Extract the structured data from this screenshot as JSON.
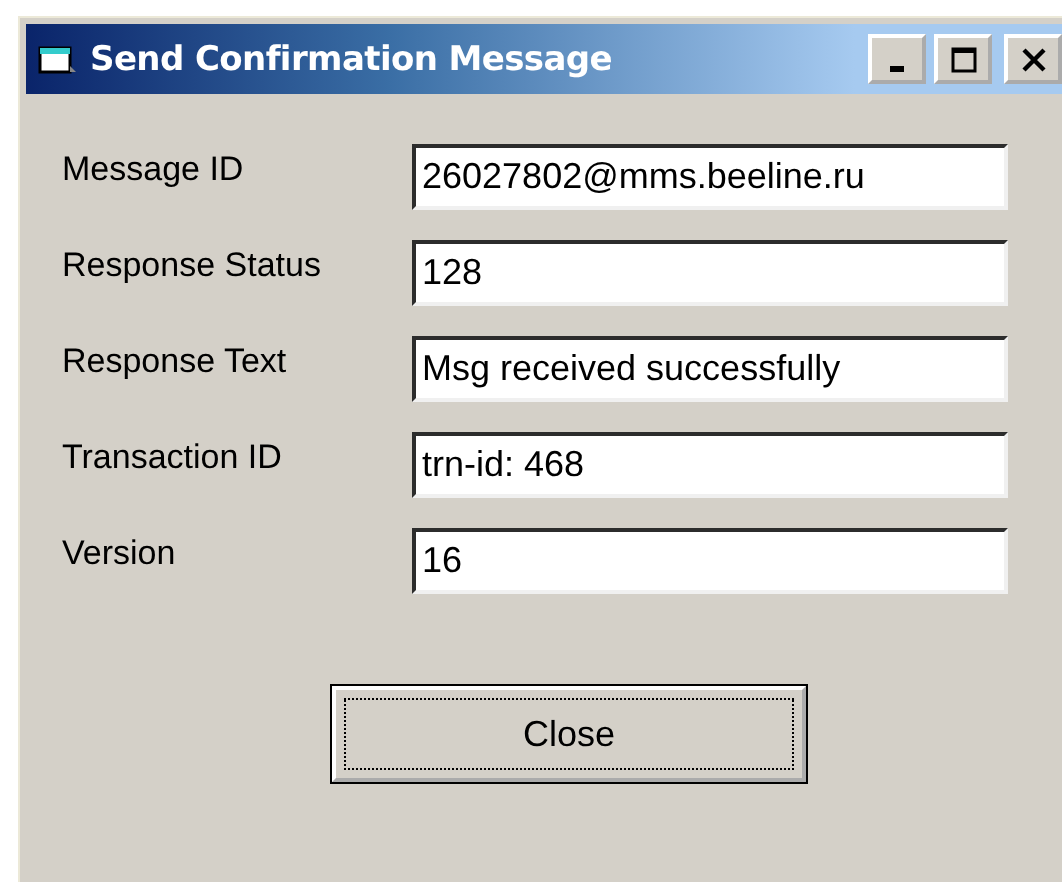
{
  "window": {
    "title": "Send Confirmation Message"
  },
  "fields": [
    {
      "label": "Message ID",
      "value": "26027802@mms.beeline.ru"
    },
    {
      "label": "Response Status",
      "value": "128"
    },
    {
      "label": "Response Text",
      "value": "Msg received successfully"
    },
    {
      "label": "Transaction ID",
      "value": "trn-id: 468"
    },
    {
      "label": "Version",
      "value": "16"
    }
  ],
  "buttons": [
    {
      "label": "Close",
      "focused": true
    }
  ]
}
